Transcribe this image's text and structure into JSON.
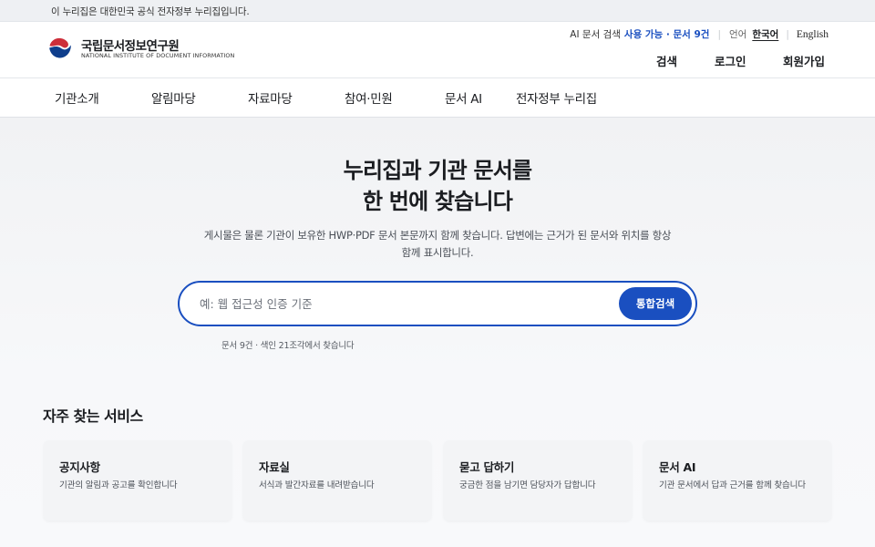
{
  "gov_bar": {
    "text": "이 누리집은 대한민국 공식 전자정부 누리집입니다."
  },
  "header": {
    "org_name": "국립문서정보연구원",
    "org_name_en": "NATIONAL INSTITUTE OF DOCUMENT INFORMATION",
    "ai_label": "AI 문서 검색",
    "ai_status": "사용 가능 · 문서 9건",
    "lang_label": "언어",
    "lang_ko": "한국어",
    "lang_en": "English",
    "links": {
      "search": "검색",
      "login": "로그인",
      "join": "회원가입"
    }
  },
  "gnb": [
    {
      "label": "기관소개"
    },
    {
      "label": "알림마당"
    },
    {
      "label": "자료마당"
    },
    {
      "label": "참여·민원"
    },
    {
      "label": "문서 AI"
    },
    {
      "label": "전자정부 누리집"
    }
  ],
  "hero": {
    "title_line1": "누리집과 기관 문서를",
    "title_line2": "한 번에 찾습니다",
    "desc_line1": "게시물은 물론 기관이 보유한 HWP·PDF 문서 본문까지 함께 찾습니다. 답변에는 근거가 된 문서와 위치를 항상",
    "desc_line2": "함께 표시합니다."
  },
  "search": {
    "placeholder": "예: 웹 접근성 인증 기준",
    "value": "",
    "button": "통합검색",
    "hint": "문서 9건 · 색인 21조각에서 찾습니다"
  },
  "services": {
    "title": "자주 찾는 서비스",
    "cards": [
      {
        "title": "공지사항",
        "desc": "기관의 알림과 공고를 확인합니다"
      },
      {
        "title": "자료실",
        "desc": "서식과 발간자료를 내려받습니다"
      },
      {
        "title": "묻고 답하기",
        "desc": "궁금한 점을 남기면 담당자가 답합니다"
      },
      {
        "title": "문서 AI",
        "desc": "기관 문서에서 답과 근거를 함께 찾습니다"
      }
    ]
  },
  "colors": {
    "accent": "#1a4fc0",
    "emblem_red": "#cd2e3a",
    "emblem_blue": "#0f3e8c"
  }
}
